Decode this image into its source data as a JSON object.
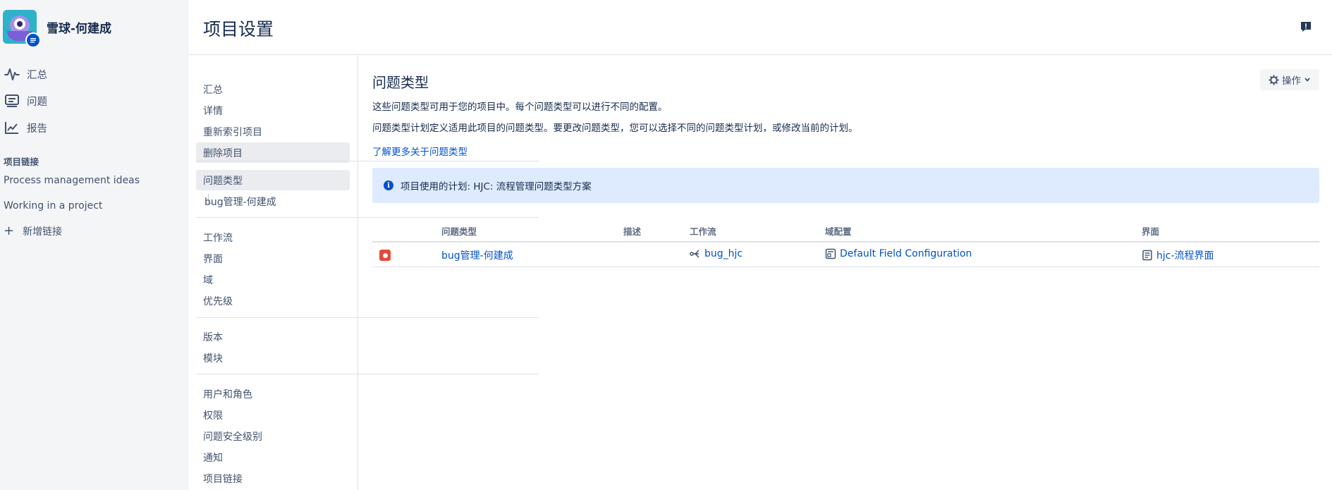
{
  "project": {
    "name": "雪球-何建成"
  },
  "sidebar": {
    "nav": [
      {
        "label": "汇总",
        "icon": "pulse-icon"
      },
      {
        "label": "问题",
        "icon": "issues-icon"
      },
      {
        "label": "报告",
        "icon": "chart-icon"
      }
    ],
    "links_title": "项目链接",
    "links": [
      "Process management ideas",
      "Working in a project"
    ],
    "add_link": "新增链接"
  },
  "page_title": "项目设置",
  "settings_nav": {
    "group1": [
      "汇总",
      "详情",
      "重新索引项目",
      "删除项目"
    ],
    "group2": {
      "main": "问题类型",
      "sub": "bug管理-何建成"
    },
    "group3": [
      "工作流",
      "界面",
      "域",
      "优先级"
    ],
    "group4": [
      "版本",
      "模块"
    ],
    "group5": [
      "用户和角色",
      "权限",
      "问题安全级别",
      "通知",
      "项目链接"
    ]
  },
  "content": {
    "title": "问题类型",
    "actions_label": "操作",
    "desc1": "这些问题类型可用于您的项目中。每个问题类型可以进行不同的配置。",
    "desc2": "问题类型计划定义适用此项目的问题类型。要更改问题类型，您可以选择不同的问题类型计划，或修改当前的计划。",
    "learn_more": "了解更多关于问题类型",
    "info": "项目使用的计划: HJC: 流程管理问题类型方案"
  },
  "table": {
    "headers": [
      "问题类型",
      "描述",
      "工作流",
      "域配置",
      "界面"
    ],
    "rows": [
      {
        "issue_type": "bug管理-何建成",
        "description": "",
        "workflow": "bug_hjc",
        "field_config": "Default Field Configuration",
        "screen": "hjc-流程界面"
      }
    ]
  },
  "colors": {
    "accent": "#0052cc",
    "bug": "#e5493a",
    "info_bg": "#deebff",
    "sidebar_bg": "#f4f5f7"
  }
}
